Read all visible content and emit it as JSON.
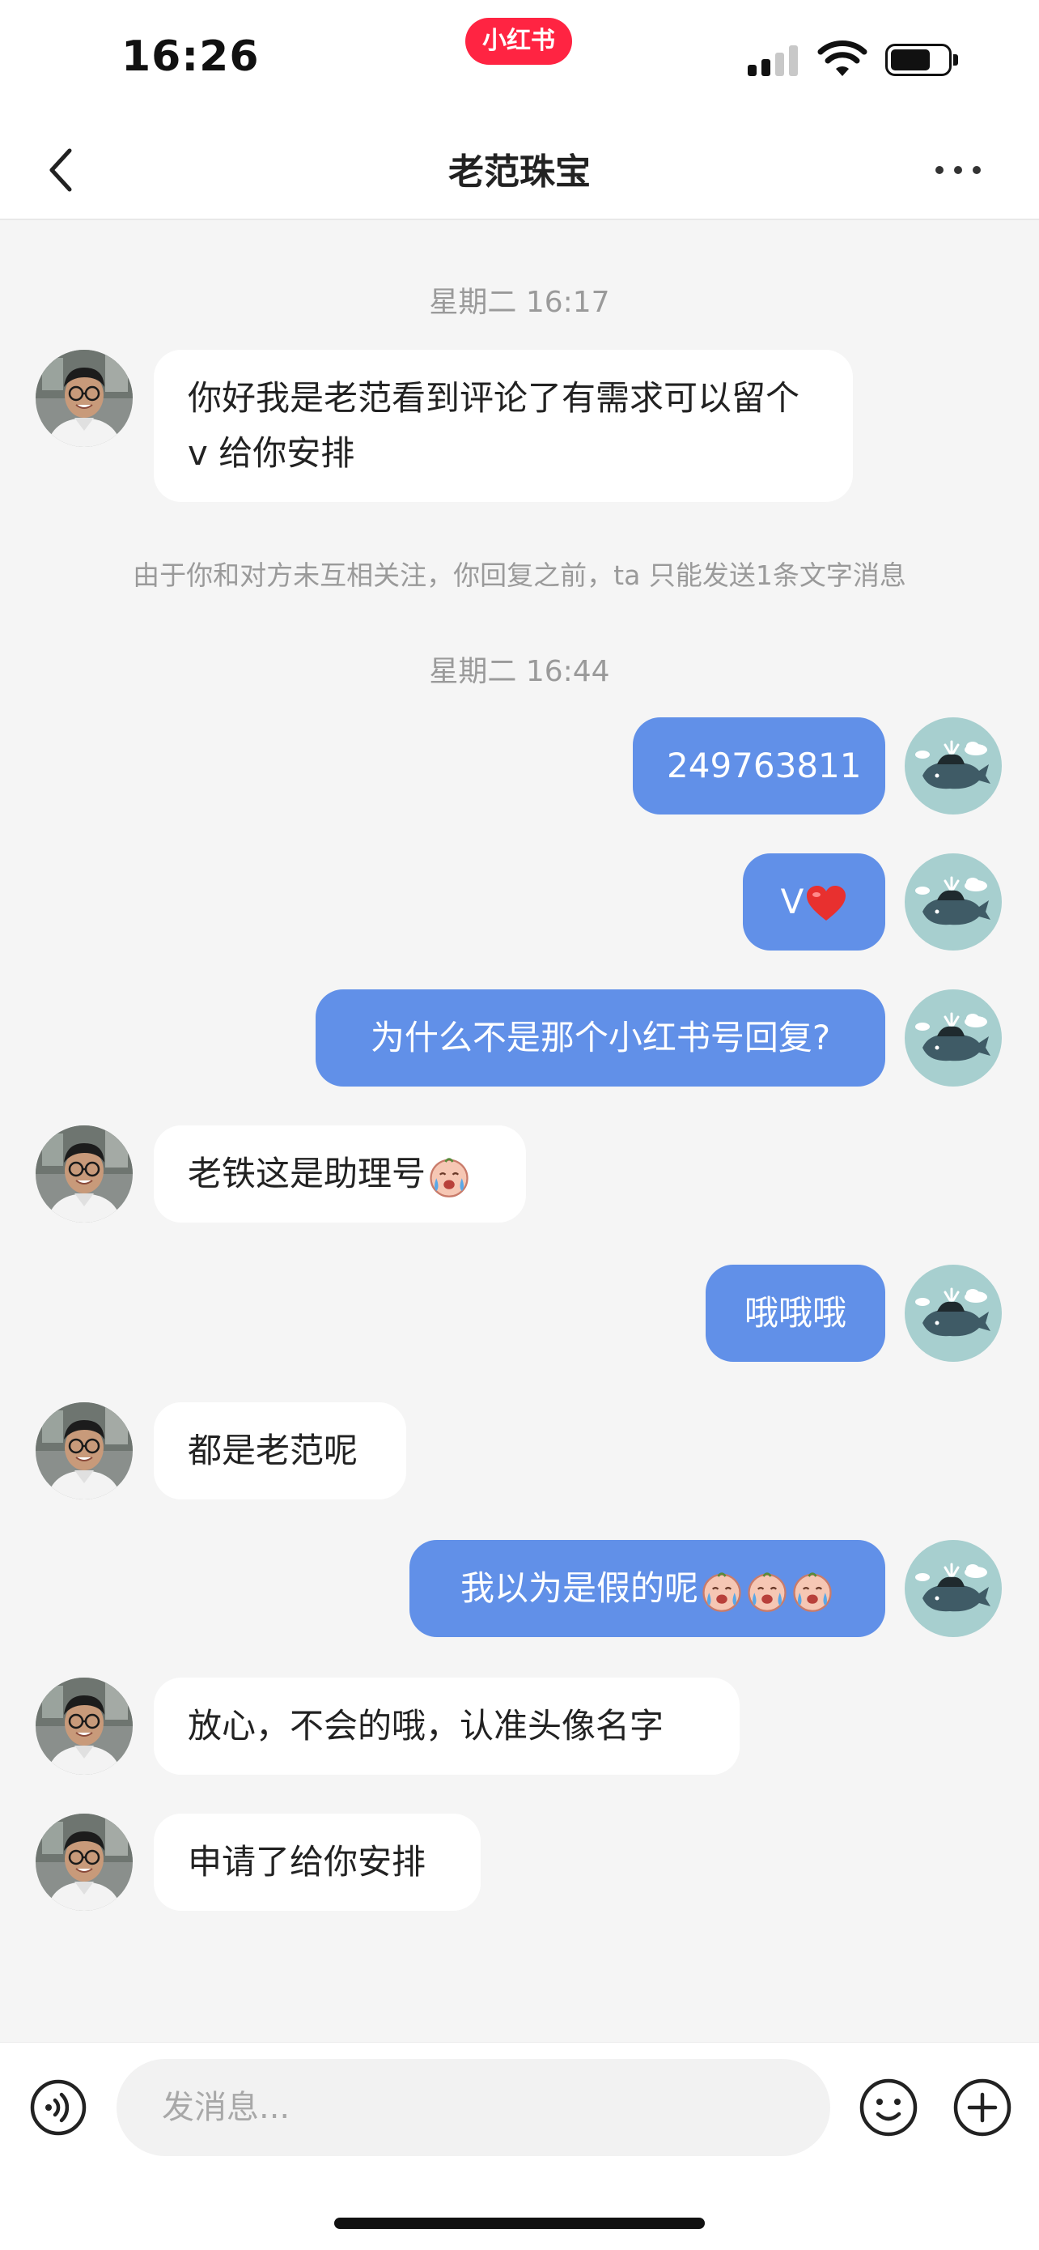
{
  "status_bar": {
    "time": "16:26",
    "app_badge": "小红书"
  },
  "nav": {
    "title": "老范珠宝"
  },
  "chat": {
    "timestamp_1": "星期二 16:17",
    "timestamp_2": "星期二 16:44",
    "system_notice": "由于你和对方未互相关注，你回复之前，ta 只能发送1条文字消息",
    "messages": [
      {
        "from": "other",
        "text": "你好我是老范看到评论了有需求可以留个 v 给你安排"
      },
      {
        "from": "me",
        "text": "249763811"
      },
      {
        "from": "me",
        "text": "V"
      },
      {
        "from": "me",
        "text": "为什么不是那个小红书号回复?"
      },
      {
        "from": "other",
        "text": "老铁这是助理号"
      },
      {
        "from": "me",
        "text": "哦哦哦"
      },
      {
        "from": "other",
        "text": "都是老范呢"
      },
      {
        "from": "me",
        "text": "我以为是假的呢"
      },
      {
        "from": "other",
        "text": "放心，不会的哦，认准头像名字"
      },
      {
        "from": "other",
        "text": "申请了给你安排"
      }
    ]
  },
  "input_bar": {
    "placeholder": "发消息..."
  },
  "colors": {
    "outgoing_bubble": "#6190e8",
    "incoming_bubble": "#ffffff",
    "brand": "#ff2442"
  }
}
